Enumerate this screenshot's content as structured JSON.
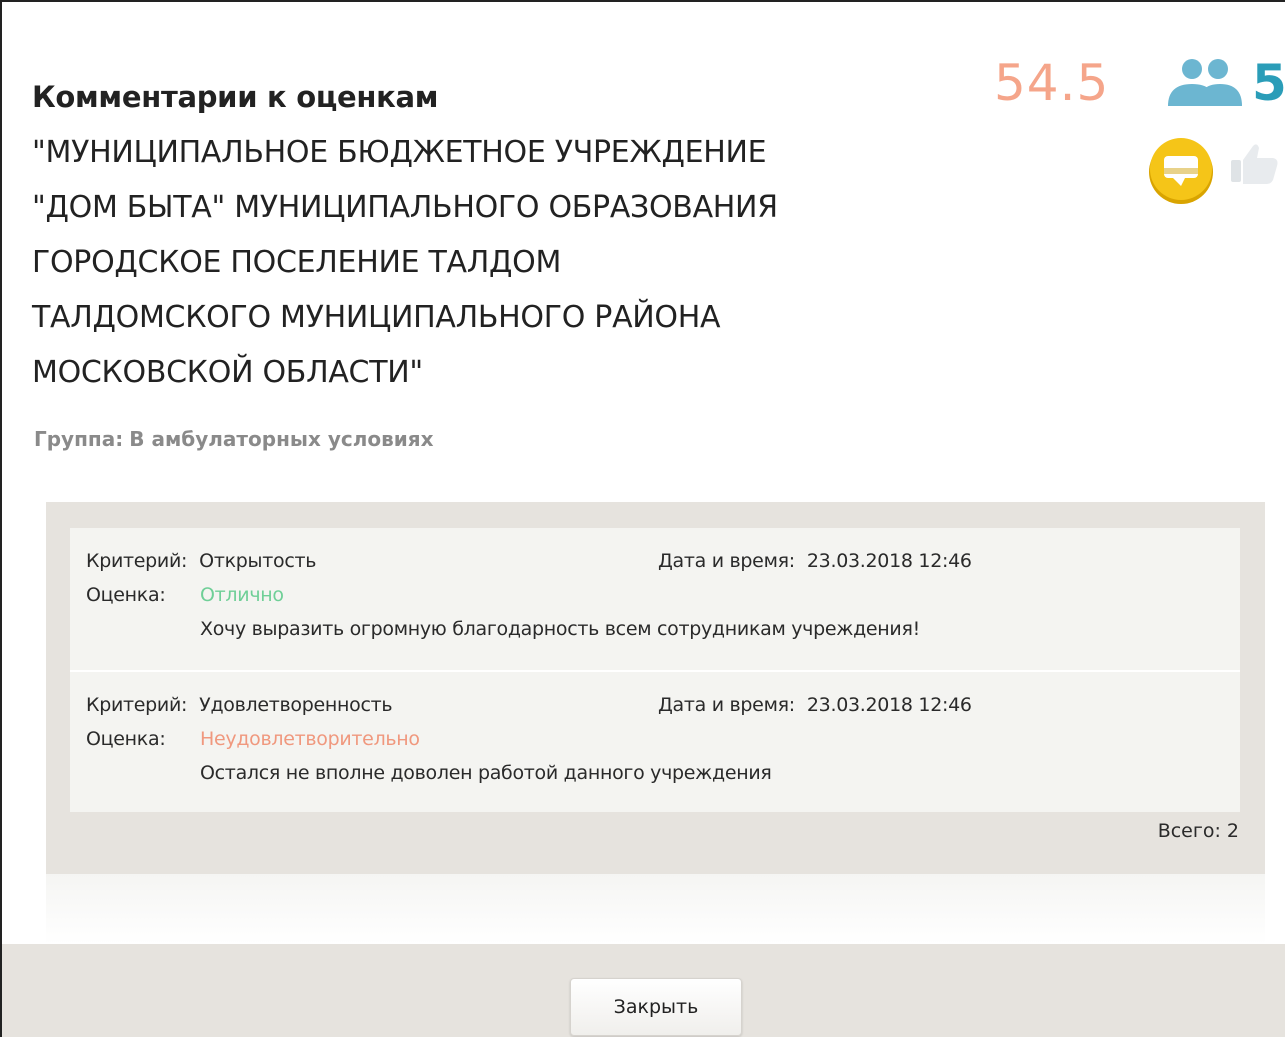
{
  "header": {
    "title_line1": "Комментарии к оценкам",
    "title_org": "\"МУНИЦИПАЛЬНОЕ БЮДЖЕТНОЕ УЧРЕЖДЕНИЕ\n\"ДОМ БЫТА\" МУНИЦИПАЛЬНОГО ОБРАЗОВАНИЯ\nГОРОДСКОЕ ПОСЕЛЕНИЕ ТАЛДОМ\nТАЛДОМСКОГО МУНИЦИПАЛЬНОГО РАЙОНА\nМОСКОВСКОЙ ОБЛАСТИ\"",
    "group_label": "Группа:",
    "group_value": "В амбулаторных условиях"
  },
  "stats": {
    "score": "54.5",
    "people_count": "5",
    "score_color": "#f5a58a",
    "people_color": "#2a9db8",
    "icons": [
      "people-icon",
      "comment-badge-icon",
      "thumbs-up-icon"
    ]
  },
  "comments": [
    {
      "criterion_label": "Критерий:",
      "criterion": "Открытость",
      "date_label": "Дата и время:",
      "date": "23.03.2018 12:46",
      "grade_label": "Оценка:",
      "grade": "Отлично",
      "grade_color": "#6fcf97",
      "text": "Хочу выразить огромную благодарность всем сотрудникам учреждения!"
    },
    {
      "criterion_label": "Критерий:",
      "criterion": "Удовлетворенность",
      "date_label": "Дата и время:",
      "date": "23.03.2018 12:46",
      "grade_label": "Оценка:",
      "grade": "Неудовлетворительно",
      "grade_color": "#f0987e",
      "text": "Остался не вполне доволен работой данного учреждения"
    }
  ],
  "summary": {
    "total": "Всего: 2"
  },
  "footer": {
    "close_label": "Закрыть"
  }
}
